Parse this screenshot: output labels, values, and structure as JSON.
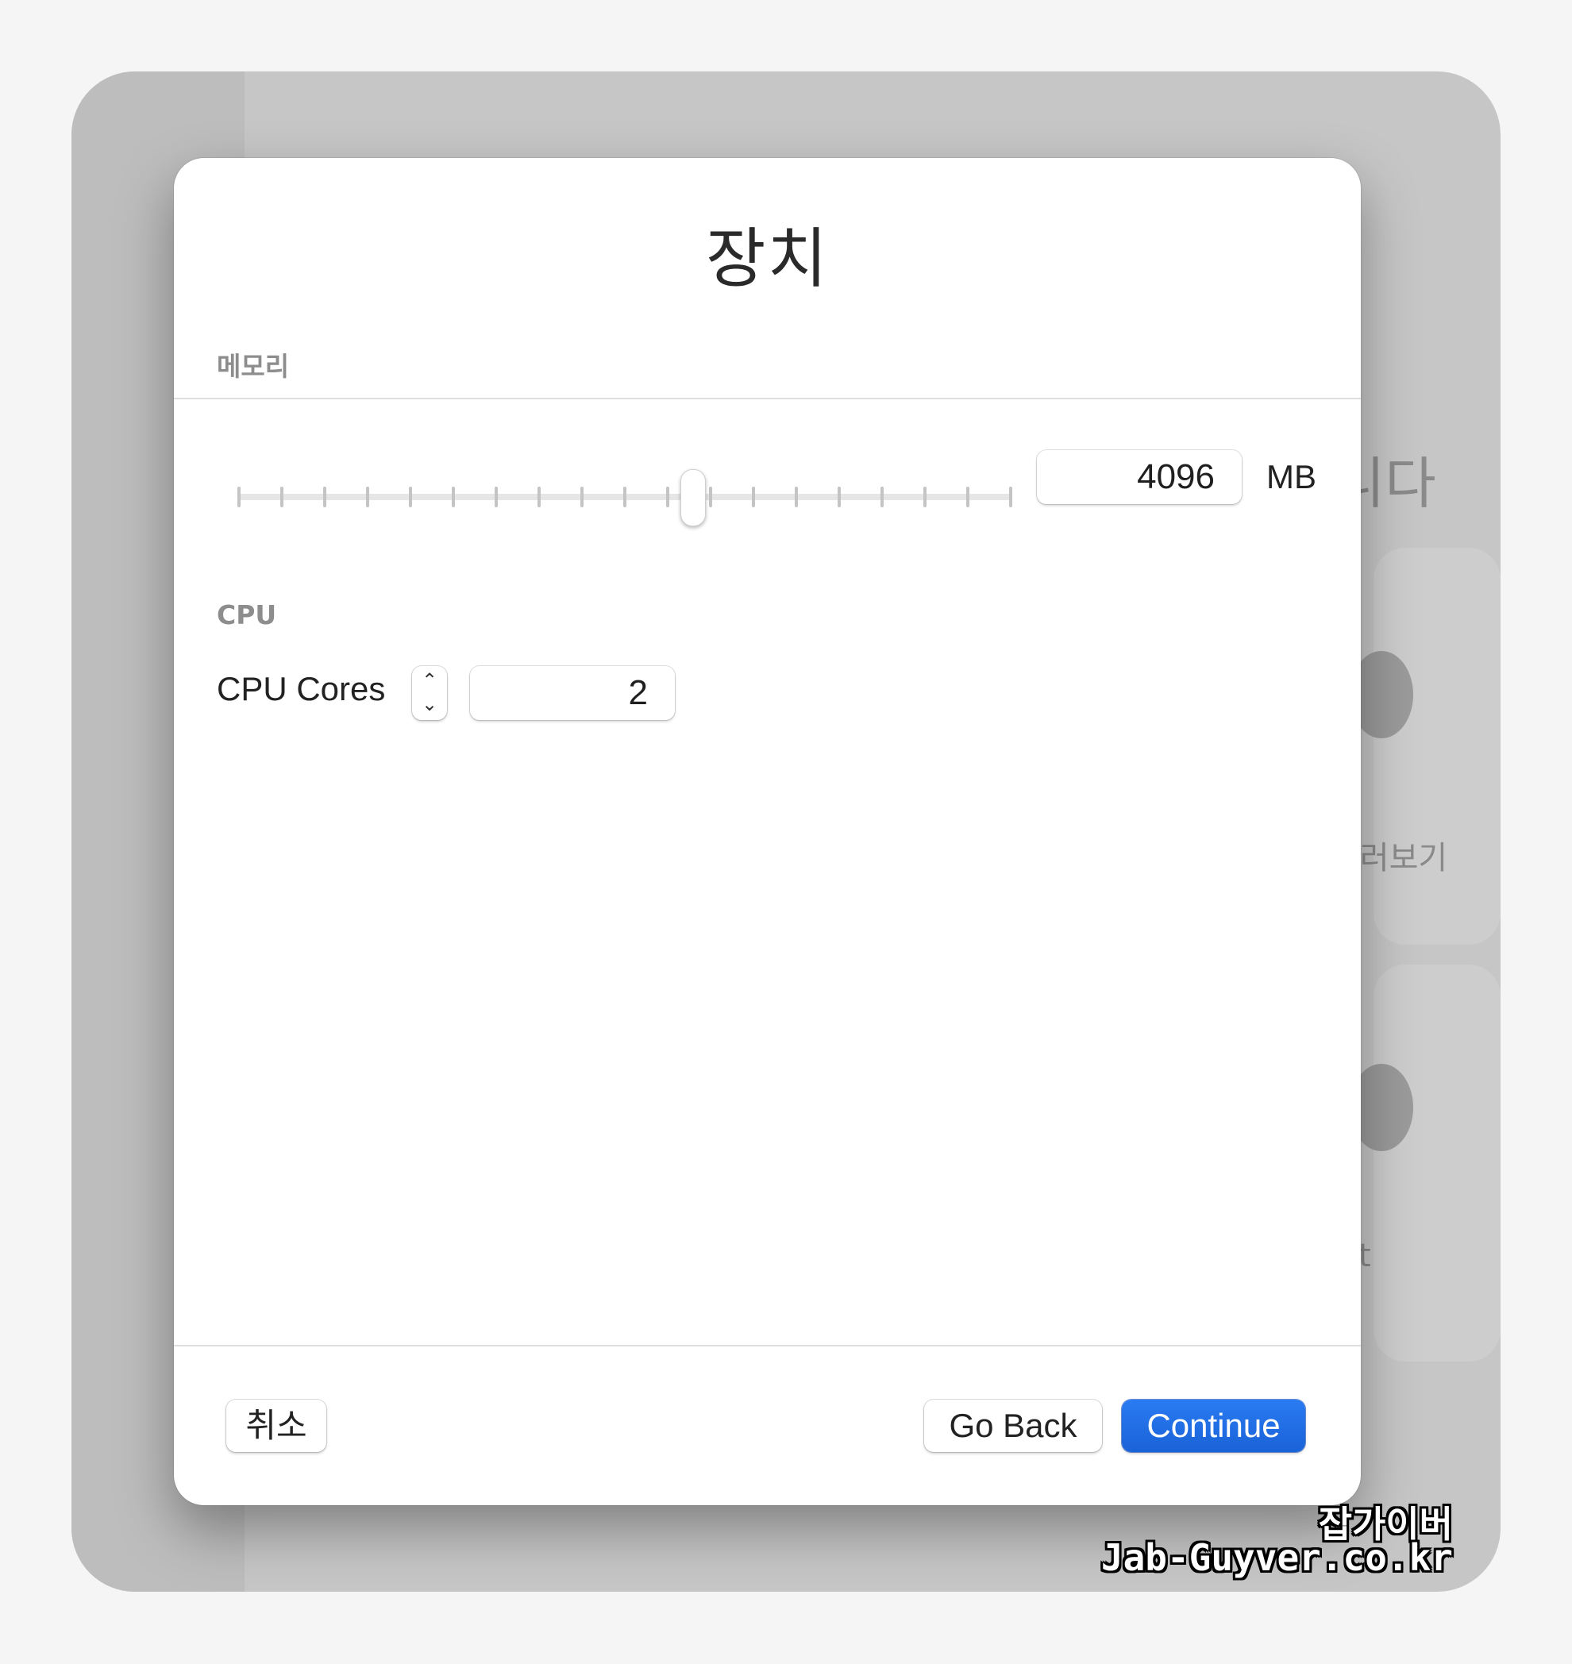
{
  "background": {
    "heading_fragment": "니다",
    "link_fragment": "둘러보기",
    "text_fragment": "t"
  },
  "dialog": {
    "title": "장치",
    "memory": {
      "section_label": "메모리",
      "slider_level": 0.587,
      "value": "4096",
      "unit": "MB"
    },
    "cpu": {
      "section_label": "CPU",
      "cores_label": "CPU Cores",
      "cores_value": "2",
      "stepper_up_icon": "chevron-up-icon",
      "stepper_down_icon": "chevron-down-icon"
    },
    "buttons": {
      "cancel": "취소",
      "go_back": "Go Back",
      "continue": "Continue"
    }
  },
  "watermark": {
    "line1": "잡가이버",
    "line2": "Jab-Guyver.co.kr"
  },
  "colors": {
    "accent": "#1f6fe5",
    "dialog_bg": "#ffffff",
    "window_bg": "#c6c6c6"
  }
}
